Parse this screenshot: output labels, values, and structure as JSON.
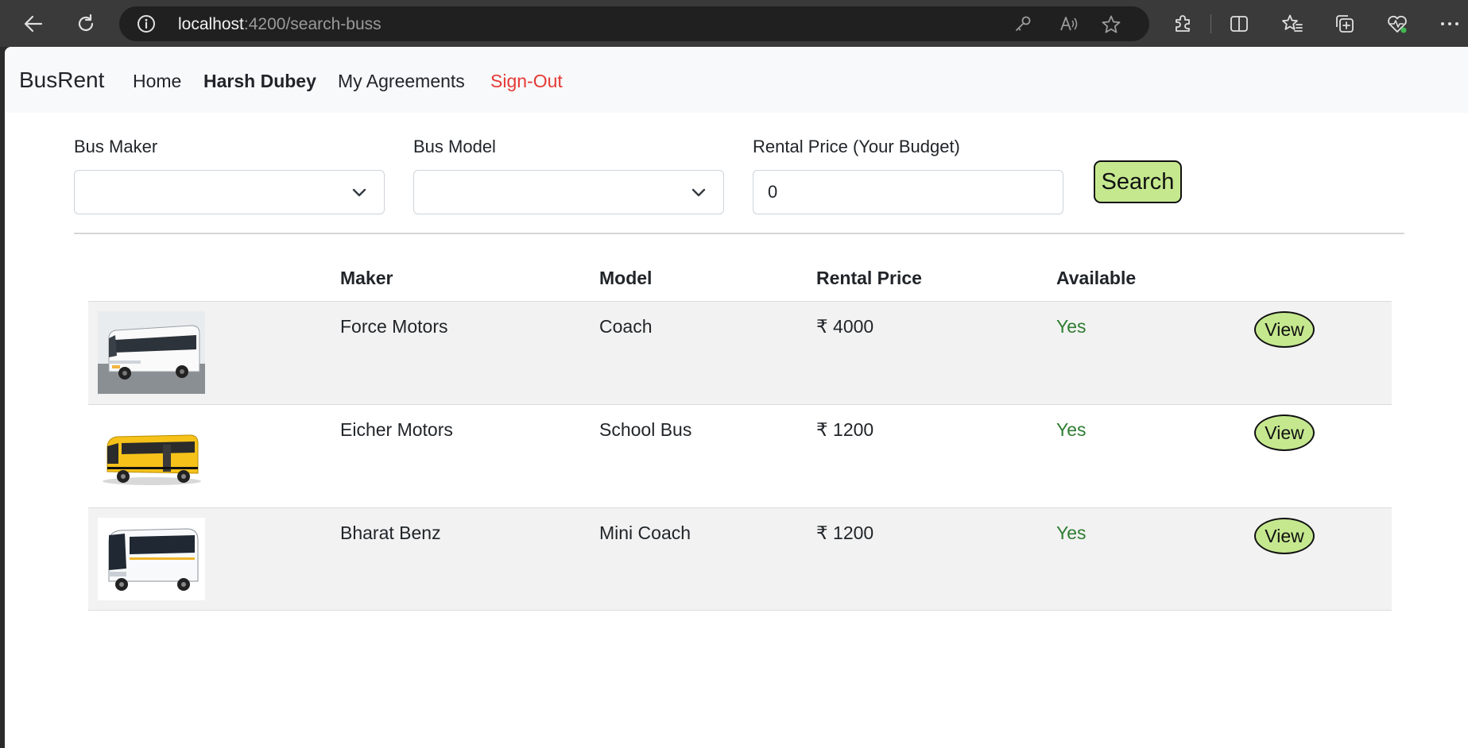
{
  "browser": {
    "url_host": "localhost",
    "url_path": ":4200/search-buss"
  },
  "navbar": {
    "brand": "BusRent",
    "links": [
      {
        "label": "Home"
      },
      {
        "label": "Harsh Dubey"
      },
      {
        "label": "My Agreements"
      },
      {
        "label": "Sign-Out"
      }
    ]
  },
  "filters": {
    "maker_label": "Bus Maker",
    "maker_value": "",
    "model_label": "Bus Model",
    "model_value": "",
    "price_label": "Rental Price (Your Budget)",
    "price_value": "0",
    "search_label": "Search"
  },
  "table": {
    "headers": [
      "",
      "Maker",
      "Model",
      "Rental Price",
      "Available"
    ],
    "rows": [
      {
        "maker": "Force Motors",
        "model": "Coach",
        "price": "₹ 4000",
        "available": "Yes",
        "action": "View"
      },
      {
        "maker": "Eicher Motors",
        "model": "School Bus",
        "price": "₹ 1200",
        "available": "Yes",
        "action": "View"
      },
      {
        "maker": "Bharat Benz",
        "model": "Mini Coach",
        "price": "₹ 1200",
        "available": "Yes",
        "action": "View"
      }
    ]
  },
  "colors": {
    "accent_button": "#c5e88f",
    "available_green": "#2e7d32",
    "signout_red": "#e53935"
  }
}
